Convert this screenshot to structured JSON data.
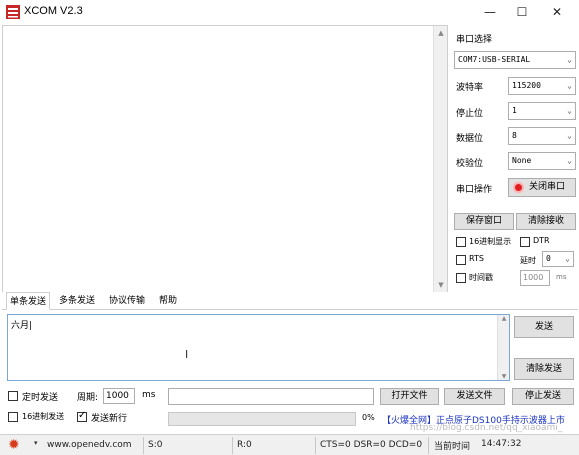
{
  "window": {
    "title": "XCOM V2.3",
    "controls": {
      "minimize": "—",
      "maximize": "☐",
      "close": "✕"
    }
  },
  "right_panel": {
    "port_select_label": "串口选择",
    "port_value": "COM7:USB-SERIAL",
    "baud_label": "波特率",
    "baud_value": "115200",
    "stopbits_label": "停止位",
    "stopbits_value": "1",
    "databits_label": "数据位",
    "databits_value": "8",
    "parity_label": "校验位",
    "parity_value": "None",
    "port_op_label": "串口操作",
    "close_port_button": "关闭串口",
    "save_window_button": "保存窗口",
    "clear_recv_button": "清除接收",
    "hex_display_label": "16进制显示",
    "dtr_label": "DTR",
    "rts_label": "RTS",
    "delay_label": "延时",
    "delay_value": "0",
    "timestamp_label": "时间戳",
    "timestamp_value": "1000",
    "timestamp_unit": "ms"
  },
  "tabs": [
    "单条发送",
    "多条发送",
    "协议传输",
    "帮助"
  ],
  "send": {
    "text": "六月|",
    "send_button": "发送",
    "clear_send_button": "清除发送"
  },
  "bottom": {
    "timed_send_label": "定时发送",
    "period_label": "周期:",
    "period_value": "1000",
    "period_unit": "ms",
    "open_file_button": "打开文件",
    "send_file_button": "发送文件",
    "stop_send_button": "停止发送",
    "hex_send_label": "16进制发送",
    "send_newline_label": "发送新行",
    "progress_percent_text": "0%",
    "progress_fraction": 0,
    "ad_text": "【火爆全网】正点原子DS100手持示波器上市"
  },
  "status_bar": {
    "url": "www.openedv.com",
    "sent": "S:0",
    "received": "R:0",
    "lines": "CTS=0 DSR=0 DCD=0",
    "time_label": "当前时间",
    "time_value": "14:47:32",
    "watermark": "https://blog.csdn.net/qq_xiaoami_"
  },
  "colors": {
    "accent_blue": "#1b4fa0",
    "ad_blue": "#1a33c2",
    "close_port_red": "#e02020"
  }
}
